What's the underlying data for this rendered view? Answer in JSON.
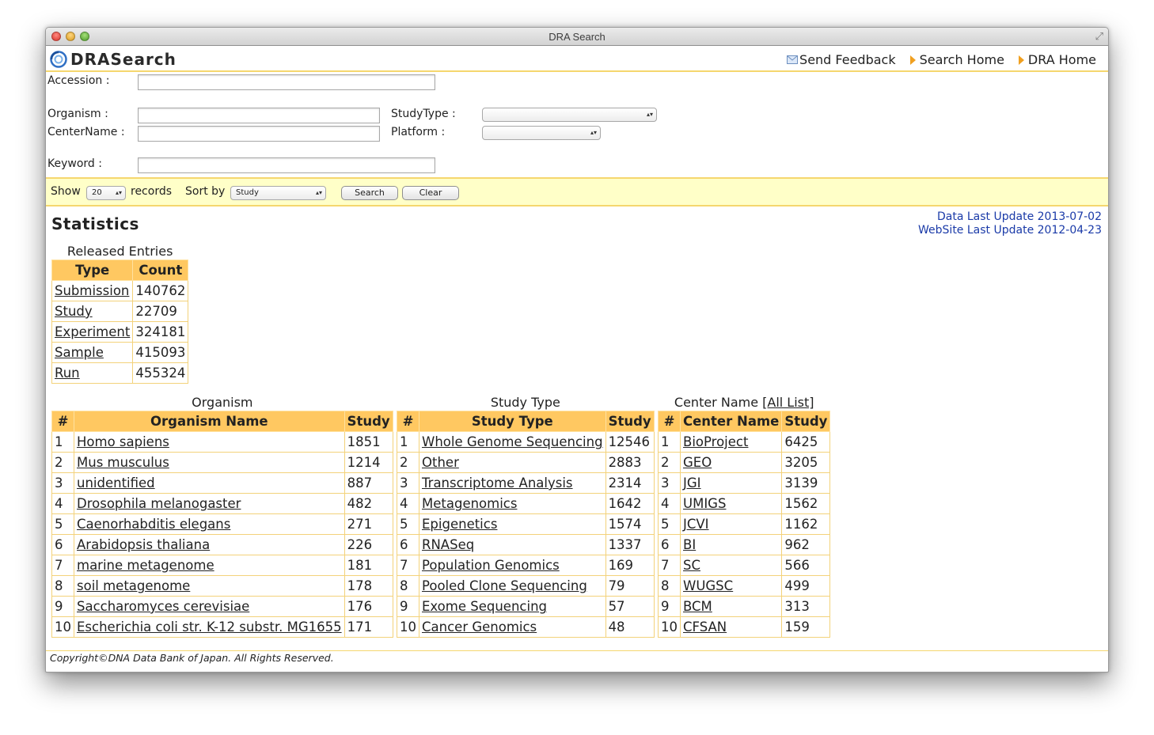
{
  "window": {
    "title": "DRA Search"
  },
  "header": {
    "logo_text": "DRASearch",
    "links": [
      {
        "label": "Send Feedback",
        "icon": "mail-icon"
      },
      {
        "label": "Search Home",
        "icon": "arrow-icon"
      },
      {
        "label": "DRA Home",
        "icon": "arrow-icon"
      }
    ]
  },
  "form": {
    "accession_label": "Accession :",
    "accession_value": "",
    "organism_label": "Organism :",
    "organism_value": "",
    "centername_label": "CenterName :",
    "centername_value": "",
    "keyword_label": "Keyword :",
    "keyword_value": "",
    "studytype_label": "StudyType :",
    "studytype_value": "",
    "platform_label": "Platform :",
    "platform_value": ""
  },
  "toolbar": {
    "show_label": "Show",
    "show_value": "20",
    "records_label": "records",
    "sortby_label": "Sort by",
    "sortby_value": "Study",
    "search_label": "Search",
    "clear_label": "Clear"
  },
  "stats": {
    "title": "Statistics",
    "data_last_update": "Data Last Update 2013-07-02",
    "website_last_update": "WebSite Last Update 2012-04-23",
    "released": {
      "caption": "Released Entries",
      "headers": [
        "Type",
        "Count"
      ],
      "rows": [
        [
          "Submission",
          "140762"
        ],
        [
          "Study",
          "22709"
        ],
        [
          "Experiment",
          "324181"
        ],
        [
          "Sample",
          "415093"
        ],
        [
          "Run",
          "455324"
        ]
      ]
    },
    "organism": {
      "caption": "Organism",
      "headers": [
        "#",
        "Organism Name",
        "Study"
      ],
      "rows": [
        [
          "1",
          "Homo sapiens",
          "1851"
        ],
        [
          "2",
          "Mus musculus",
          "1214"
        ],
        [
          "3",
          "unidentified",
          "887"
        ],
        [
          "4",
          "Drosophila melanogaster",
          "482"
        ],
        [
          "5",
          "Caenorhabditis elegans",
          "271"
        ],
        [
          "6",
          "Arabidopsis thaliana",
          "226"
        ],
        [
          "7",
          "marine metagenome",
          "181"
        ],
        [
          "8",
          "soil metagenome",
          "178"
        ],
        [
          "9",
          "Saccharomyces cerevisiae",
          "176"
        ],
        [
          "10",
          "Escherichia coli str. K-12 substr. MG1655",
          "171"
        ]
      ]
    },
    "studytype": {
      "caption": "Study Type",
      "headers": [
        "#",
        "Study Type",
        "Study"
      ],
      "rows": [
        [
          "1",
          "Whole Genome Sequencing",
          "12546"
        ],
        [
          "2",
          "Other",
          "2883"
        ],
        [
          "3",
          "Transcriptome Analysis",
          "2314"
        ],
        [
          "4",
          "Metagenomics",
          "1642"
        ],
        [
          "5",
          "Epigenetics",
          "1574"
        ],
        [
          "6",
          "RNASeq",
          "1337"
        ],
        [
          "7",
          "Population Genomics",
          "169"
        ],
        [
          "8",
          "Pooled Clone Sequencing",
          "79"
        ],
        [
          "9",
          "Exome Sequencing",
          "57"
        ],
        [
          "10",
          "Cancer Genomics",
          "48"
        ]
      ]
    },
    "center": {
      "caption": "Center Name",
      "all_list": "[All List]",
      "headers": [
        "#",
        "Center Name",
        "Study"
      ],
      "rows": [
        [
          "1",
          "BioProject",
          "6425"
        ],
        [
          "2",
          "GEO",
          "3205"
        ],
        [
          "3",
          "JGI",
          "3139"
        ],
        [
          "4",
          "UMIGS",
          "1562"
        ],
        [
          "5",
          "JCVI",
          "1162"
        ],
        [
          "6",
          "BI",
          "962"
        ],
        [
          "7",
          "SC",
          "566"
        ],
        [
          "8",
          "WUGSC",
          "499"
        ],
        [
          "9",
          "BCM",
          "313"
        ],
        [
          "10",
          "CFSAN",
          "159"
        ]
      ]
    }
  },
  "footer": {
    "copyright": "Copyright©DNA Data Bank of Japan. All Rights Reserved."
  }
}
